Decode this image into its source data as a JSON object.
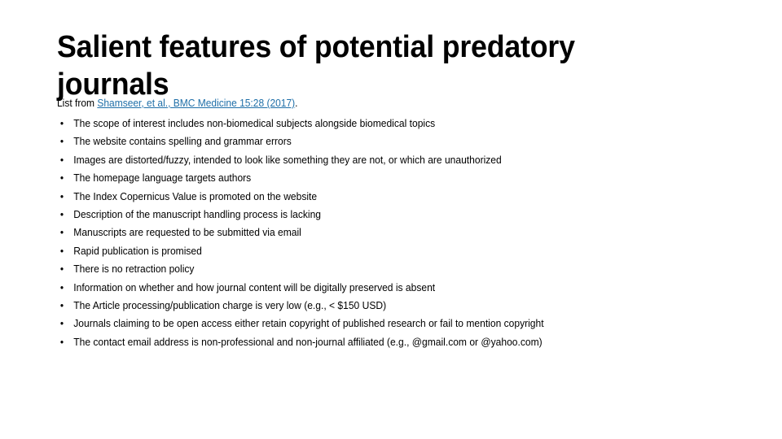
{
  "slide": {
    "title": "Salient features of potential predatory journals",
    "background_color": "#FFFFFF",
    "text_color": "#000000",
    "link_color": "#1F6FA8",
    "bullet_glyph": "•",
    "intro": {
      "prefix": "List from ",
      "link_text": "Shamseer, et al., BMC Medicine 15:28 (2017)",
      "suffix": "."
    },
    "bullets": [
      "The scope of interest includes non-biomedical subjects alongside biomedical topics",
      "The website contains spelling and grammar errors",
      "Images are distorted/fuzzy, intended to look like something they are not, or which are unauthorized",
      "The homepage language targets authors",
      "The Index Copernicus Value is promoted on the website",
      "Description of the manuscript handling process is lacking",
      "Manuscripts are requested to be submitted via email",
      "Rapid publication is promised",
      "There is no retraction policy",
      "Information on whether and how journal content will be digitally preserved is absent",
      "The Article processing/publication charge is very low (e.g., < $150 USD)",
      "Journals claiming to be open access either retain copyright of published research or fail to mention copyright",
      "The contact email address is non-professional and non-journal affiliated (e.g., @gmail.com or @yahoo.com)"
    ]
  }
}
